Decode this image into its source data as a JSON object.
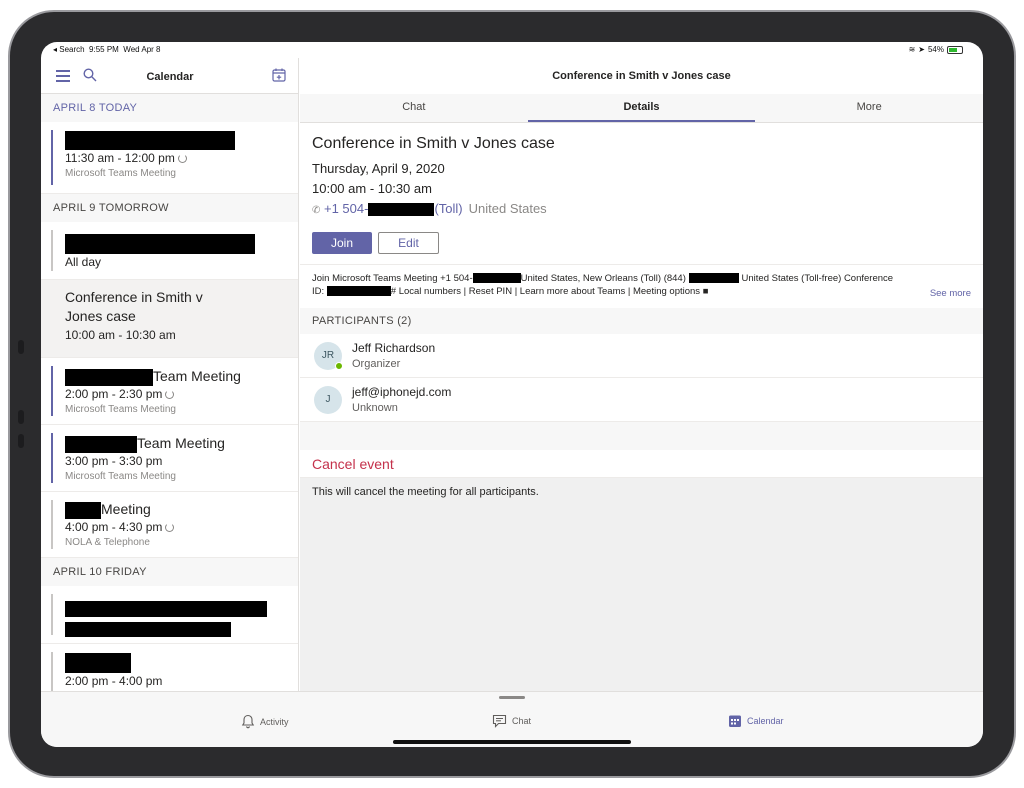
{
  "status_bar": {
    "back": "◂ Search",
    "time": "9:55 PM",
    "date": "Wed Apr 8",
    "battery": "54%"
  },
  "left": {
    "title": "Calendar",
    "days": [
      {
        "label": "APRIL 8  TODAY"
      },
      {
        "label": "APRIL 9  TOMORROW"
      },
      {
        "label": "APRIL 10  FRIDAY"
      }
    ],
    "events": [
      {
        "title": "",
        "time": "11:30 am - 12:00 pm",
        "sub": "Microsoft Teams Meeting"
      },
      {
        "title": "",
        "time": "All day",
        "sub": ""
      },
      {
        "title": "Conference in Smith v Jones case",
        "time": "10:00 am - 10:30 am",
        "sub": ""
      },
      {
        "title": "Team Meeting",
        "time": "2:00 pm - 2:30 pm",
        "sub": "Microsoft Teams Meeting"
      },
      {
        "title": "Team Meeting",
        "time": "3:00 pm - 3:30 pm",
        "sub": "Microsoft Teams Meeting"
      },
      {
        "title": "Meeting",
        "time": "4:00 pm - 4:30 pm",
        "sub": "NOLA & Telephone"
      },
      {
        "title": "",
        "time": "",
        "sub": ""
      },
      {
        "title": "",
        "time": "2:00 pm - 4:00 pm",
        "sub": ""
      }
    ]
  },
  "right": {
    "header_title": "Conference in Smith v Jones case",
    "tabs": [
      "Chat",
      "Details",
      "More"
    ],
    "details": {
      "title": "Conference in Smith v Jones case",
      "date": "Thursday, April 9, 2020",
      "time": "10:00 am - 10:30 am",
      "phone_prefix": "+1 504-",
      "phone_suffix": "(Toll)",
      "country": "United States",
      "join_label": "Join",
      "edit_label": "Edit",
      "info_a": "Join Microsoft Teams Meeting +1 504-",
      "info_b": "United States, New Orleans (Toll) (844)",
      "info_c": " United States (Toll-free) Conference",
      "info_d": "ID: ",
      "info_e": "# Local numbers | Reset PIN | Learn more about Teams | Meeting options",
      "see_more": "See more"
    },
    "participants_label": "PARTICIPANTS (2)",
    "participants": [
      {
        "initials": "JR",
        "name": "Jeff Richardson",
        "role": "Organizer"
      },
      {
        "initials": "J",
        "name": "jeff@iphonejd.com",
        "role": "Unknown"
      }
    ],
    "cancel_label": "Cancel event",
    "cancel_desc": "This will cancel the meeting for all participants."
  },
  "nav": {
    "activity": "Activity",
    "chat": "Chat",
    "calendar": "Calendar"
  },
  "colors": {
    "accent": "#6264a7",
    "danger": "#c4314b"
  }
}
